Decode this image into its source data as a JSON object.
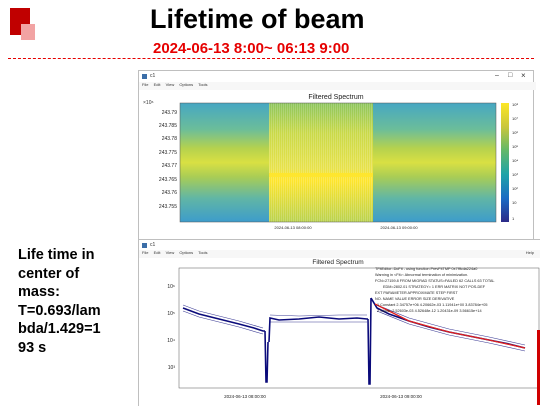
{
  "slide": {
    "title": "Lifetime of beam",
    "subtitle": "2024-06-13 8:00~ 06:13 9:00",
    "lifetime_text": "Life time in center of mass: T=0.693/lambda/1.429=193 s",
    "lifetime_lines": [
      "Life time in",
      "center of",
      "mass:",
      "T=0.693/lam",
      "bda/1.429=1",
      "93 s"
    ]
  },
  "window_top": {
    "title": "c1",
    "menu": [
      "File",
      "Edit",
      "View",
      "Options",
      "Tools"
    ],
    "controls": {
      "minimize": "–",
      "maximize": "□",
      "close": "×"
    },
    "plot_title": "Filtered Spectrum",
    "y_exponent": "×10⁶",
    "y_ticks": [
      "243.785",
      "243.78",
      "243.775",
      "243.77",
      "243.765",
      "243.76",
      "243.755"
    ],
    "y_ticks_extra": [
      "243.79"
    ],
    "x_ticks": [
      "2024-06-13 08:00:00",
      "2024-06-13 09:00:00"
    ],
    "colorbar_ticks": [
      "10⁸",
      "10⁷",
      "10⁶",
      "10⁵",
      "10⁴",
      "10³",
      "10²",
      "10",
      "1"
    ],
    "colors": {
      "low": "#3aa1c8",
      "mid": "#95c55c",
      "high": "#ffe52b"
    }
  },
  "window_bottom": {
    "title": "c1",
    "menu": [
      "File",
      "Edit",
      "View",
      "Options",
      "Tools"
    ],
    "help": "Help",
    "plot_title": "Filtered Spectrum",
    "y_ticks": [
      "10⁶",
      "10⁵",
      "10⁴",
      "10³"
    ],
    "x_ticks": [
      "2024-06-13 08:00:00",
      "2024-06-13 09:00:00"
    ],
    "fit_info": [
      "TFitEditor::DoFit - using function PrevFitTMP  0x7fffcda224a0",
      "Warning in <Fit>: Abnormal termination of minimization.",
      "FCN=27159.8 FROM MIGRAD    STATUS=FAILED      62 CALLS        63 TOTAL",
      "EDM=2802.01    STRATEGY= 1      ERR MATRIX NOT POS-DEF",
      "EXT PARAMETER                APPROXIMATE        STEP         FIRST",
      "NO.   NAME      VALUE           ERROR          SIZE      DERIVATIVE",
      "1  Constant   2.34757e+06   4.20662e-03   1.11941e+00   3.83784e+05",
      "2  Slope     -2.52603e-03   4.52648e-12   1.20431e-09   3.56615e+14"
    ],
    "colors": {
      "data": "#0a0a7a",
      "fit": "#e0201e"
    }
  }
}
